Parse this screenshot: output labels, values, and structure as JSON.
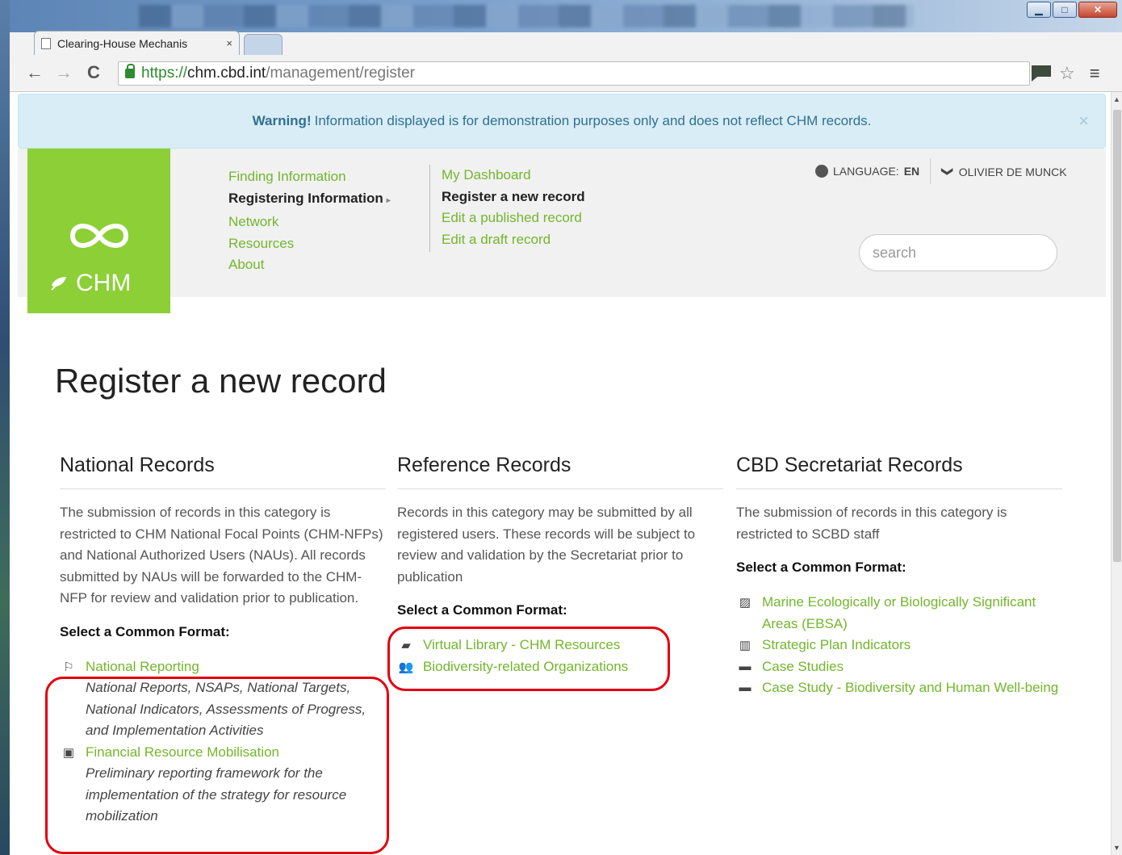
{
  "browser": {
    "tab_title": "Clearing-House Mechanis",
    "tab_close": "×",
    "url_scheme": "https://",
    "url_host": "chm.cbd.int",
    "url_path": "/management/register",
    "back": "←",
    "forward": "→",
    "reload": "C",
    "star": "☆",
    "menu": "≡",
    "min": "▁",
    "max": "□",
    "close": "✕"
  },
  "warning": {
    "strong": "Warning!",
    "text": "Information displayed is for demonstration purposes only and does not reflect CHM records.",
    "close": "×"
  },
  "logo": {
    "text": "CHM"
  },
  "nav": {
    "primary": [
      "Finding Information",
      "Registering Information",
      "Network",
      "Resources",
      "About"
    ],
    "caret": "▸",
    "secondary": [
      "My Dashboard",
      "Register a new record",
      "Edit a published record",
      "Edit a draft record"
    ],
    "language_label": "LANGUAGE:",
    "language_value": "EN",
    "user_name": "OLIVIER DE MUNCK",
    "chevron": "❯"
  },
  "search": {
    "placeholder": "search"
  },
  "page": {
    "title": "Register a new record"
  },
  "columns": [
    {
      "title": "National Records",
      "description": "The submission of records in this category is restricted to CHM National Focal Points (CHM-NFPs) and National Authorized Users (NAUs). All records submitted by NAUs will be forwarded to the CHM-NFP for review and validation prior to publication.",
      "select_label": "Select a Common Format:",
      "items": [
        {
          "label": "National Reporting",
          "sub": "National Reports, NSAPs, National Targets, National Indicators, Assessments of Progress, and Implementation Activities",
          "icon": "flag-icon",
          "glyph": "⚐"
        },
        {
          "label": "Financial Resource Mobilisation",
          "sub": "Preliminary reporting framework for the implementation of the strategy for resource mobilization",
          "icon": "money-icon",
          "glyph": "▣"
        }
      ]
    },
    {
      "title": "Reference Records",
      "description": "Records in this category may be submitted by all registered users. These records will be subject to review and validation by the Secretariat prior to publication",
      "select_label": "Select a Common Format:",
      "items": [
        {
          "label": "Virtual Library - CHM Resources",
          "icon": "book-icon",
          "glyph": "▰"
        },
        {
          "label": "Biodiversity-related Organizations",
          "icon": "users-icon",
          "glyph": "👥"
        }
      ]
    },
    {
      "title": "CBD Secretariat Records",
      "description": "The submission of records in this category is restricted to SCBD staff",
      "select_label": "Select a Common Format:",
      "items": [
        {
          "label": "Marine Ecologically or Biologically Significant Areas (EBSA)",
          "icon": "picture-icon",
          "glyph": "▨"
        },
        {
          "label": "Strategic Plan Indicators",
          "icon": "bar-chart-icon",
          "glyph": "▥"
        },
        {
          "label": "Case Studies",
          "icon": "folder-open-icon",
          "glyph": "▬"
        },
        {
          "label": "Case Study - Biodiversity and Human Well-being",
          "icon": "folder-open-icon",
          "glyph": "▬"
        }
      ]
    }
  ],
  "colors": {
    "brand_green": "#8ccf36",
    "link_green": "#73b62c",
    "highlight_red": "#e3000f",
    "warning_bg": "#d9edf7"
  }
}
